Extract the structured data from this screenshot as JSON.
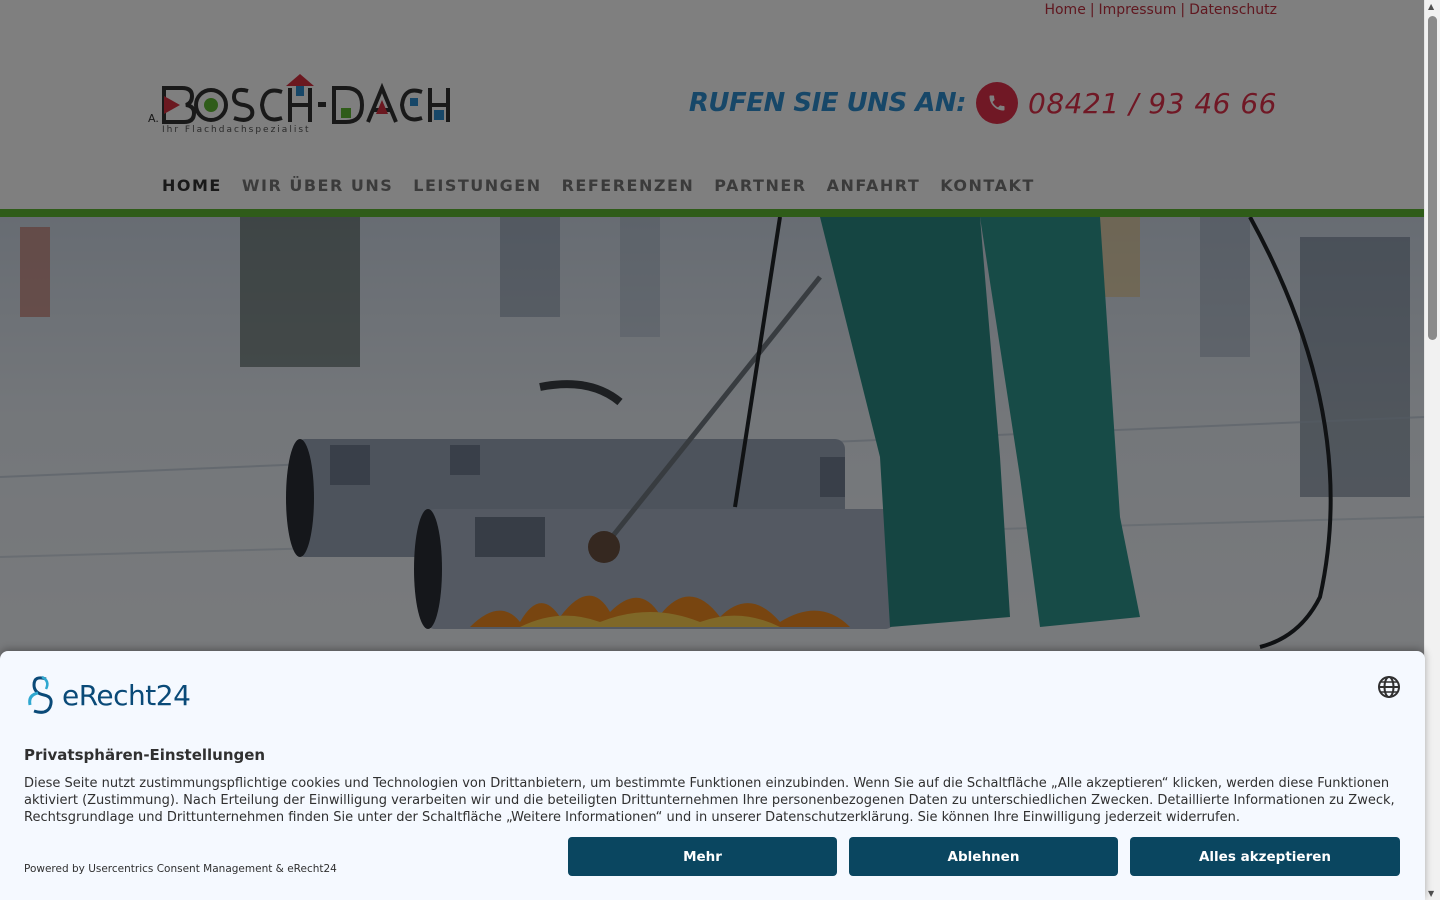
{
  "header": {
    "top_links": [
      "Home",
      "Impressum",
      "Datenschutz"
    ],
    "top_sep": "|",
    "logo_text": "BOSCH-DACH",
    "logo_prefix": "A.",
    "tagline": "Ihr Flachdachspezialist",
    "phone_cta": "RUFEN SIE UNS AN:",
    "phone_number": "08421 / 93 46 66",
    "nav": [
      "HOME",
      "WIR ÜBER UNS",
      "LEISTUNGEN",
      "REFERENZEN",
      "PARTNER",
      "ANFAHRT",
      "KONTAKT"
    ],
    "accent_green": "#5fb832",
    "accent_red": "#e0304a",
    "accent_blue": "#2f8fd0"
  },
  "hero": {
    "image": "roofer-torch-roll-icon"
  },
  "consent": {
    "brand": "eRecht24",
    "title": "Privatsphären-Einstellungen",
    "text": "Diese Seite nutzt zustimmungspflichtige cookies und Technologien von Drittanbietern, um bestimmte Funktionen einzubinden. Wenn Sie auf die Schaltfläche „Alle akzeptieren“ klicken, werden diese Funktionen aktiviert (Zustimmung). Nach Erteilung der Einwilligung verarbeiten wir und die beteiligten Drittunternehmen Ihre personenbezogenen Daten zu unterschiedlichen Zwecken. Detaillierte Informationen zu Zweck, Rechtsgrundlage und Drittunternehmen finden Sie unter der Schaltfläche „Weitere Informationen“ und in unserer Datenschutzerklärung. Sie können Ihre Einwilligung jederzeit widerrufen.",
    "powered_by": "Powered by Usercentrics Consent Management & eRecht24",
    "buttons": {
      "more": "Mehr",
      "reject": "Ablehnen",
      "accept_all": "Alles akzeptieren"
    },
    "button_color": "#0a4660"
  }
}
